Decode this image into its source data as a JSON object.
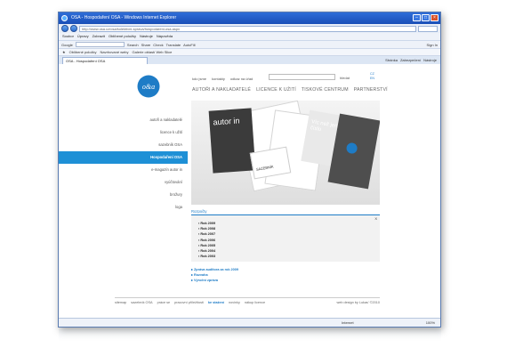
{
  "window": {
    "title": "OSA - Hospodaření OSA - Windows Internet Explorer",
    "url": "http://www.osa.cz/osa/kolektivni-sprava/hospodareni-osa.aspx"
  },
  "menubar": [
    "Soubor",
    "Úpravy",
    "Zobrazit",
    "Oblíbené položky",
    "Nástroje",
    "Nápověda"
  ],
  "google": {
    "label": "Google",
    "search": "Search",
    "share": "Share",
    "check": "Check",
    "translate": "Translate",
    "autofill": "AutoFill",
    "signin": "Sign In"
  },
  "favorites": {
    "label": "Oblíbené položky",
    "items": [
      "Navrhované weby",
      "Galerie oblastí Web Slice"
    ]
  },
  "tab": {
    "label": "OSA - Hospodaření OSA"
  },
  "commandbar": [
    "Stránka",
    "Zabezpečení",
    "Nástroje"
  ],
  "status": {
    "zone": "Internet",
    "zoom": "100%"
  },
  "site": {
    "top_links": [
      "kdo jsme",
      "kontakty",
      "odkaz na úřad"
    ],
    "search_label": "hledat",
    "languages": [
      "CZ",
      "EN"
    ],
    "main_nav": [
      "AUTOŘI A NAKLADATELÉ",
      "LICENCE K UŽITÍ",
      "TISKOVÉ CENTRUM",
      "PARTNERSTVÍ"
    ],
    "left_menu": [
      {
        "label": "autoři a nakladatelé",
        "active": false
      },
      {
        "label": "licence k užití",
        "active": false
      },
      {
        "label": "sazebník OSA",
        "active": false
      },
      {
        "label": "Hospodaření OSA",
        "active": true
      },
      {
        "label": "e-magazín autor in",
        "active": false
      },
      {
        "label": "vyúčtování",
        "active": false
      },
      {
        "label": "brožury",
        "active": false
      },
      {
        "label": "loga",
        "active": false
      }
    ],
    "hero": {
      "magazine": "autor in",
      "sazebnik": "SAZEBNÍK",
      "card": "Víc než jen číslo",
      "card_line2": "s osa"
    },
    "rozpocty": {
      "heading": "Rozpočty",
      "close": "X",
      "years": [
        "Rok 2009",
        "Rok 2008",
        "Rok 2007",
        "Rok 2006",
        "Rok 2005",
        "Rok 2004",
        "Rok 2003"
      ]
    },
    "links": [
      "Zpráva auditora za rok 2009",
      "Rozvaha",
      "Výroční zpráva"
    ],
    "footer": {
      "items": [
        "sitemap",
        "sazebník OSA",
        "práce se",
        "pracovní příležitosti",
        "ke stažení",
        "novinky",
        "nákup licence"
      ],
      "bold_index": 4,
      "credit": "web design by Lukas' ©2010"
    }
  },
  "colors": {
    "accent": "#1e90d6",
    "link": "#1e7cc6",
    "titlebar": "#1f57c3"
  }
}
